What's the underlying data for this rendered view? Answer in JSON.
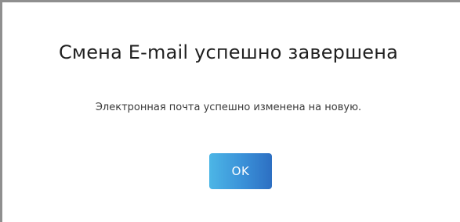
{
  "dialog": {
    "title": "Смена E-mail успешно завершена",
    "message": "Электронная почта успешно изменена на новую.",
    "ok_label": "OK"
  },
  "colors": {
    "button_gradient_start": "#4cb6e6",
    "button_gradient_end": "#2d6fc2",
    "title_text": "#1f1f1f",
    "message_text": "#3a3a3a"
  }
}
